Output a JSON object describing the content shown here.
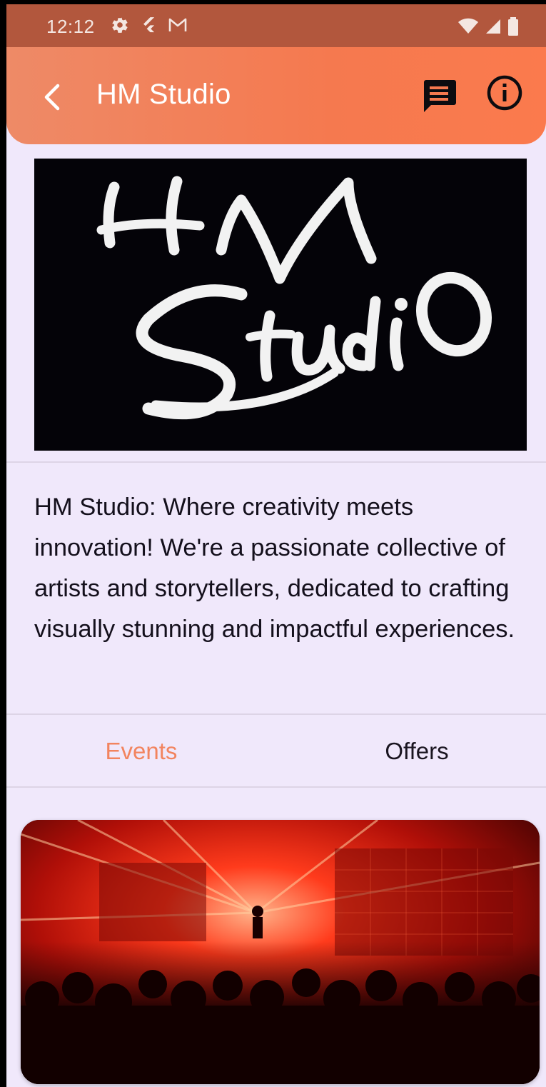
{
  "status_bar": {
    "time": "12:12",
    "left_icons": [
      "gear-icon",
      "flutter-icon",
      "gmail-icon"
    ],
    "right_icons": [
      "wifi-icon",
      "signal-icon",
      "battery-icon"
    ]
  },
  "app_bar": {
    "title": "HM Studio",
    "back_icon": "chevron-left-icon",
    "actions": [
      "chat-icon",
      "info-icon"
    ]
  },
  "logo": {
    "text_top": "H M",
    "text_bottom": "Studio"
  },
  "description": "HM Studio: Where creativity meets innovation! We're a passionate collective of artists and storytellers, dedicated to crafting visually stunning and impactful experiences.",
  "tabs": [
    {
      "label": "Events",
      "selected": true
    },
    {
      "label": "Offers",
      "selected": false
    }
  ],
  "colors": {
    "accent": "#f2845f",
    "app_bar": "#f5794f",
    "status_bar": "#b2573d",
    "background": "#f0e8fb"
  }
}
